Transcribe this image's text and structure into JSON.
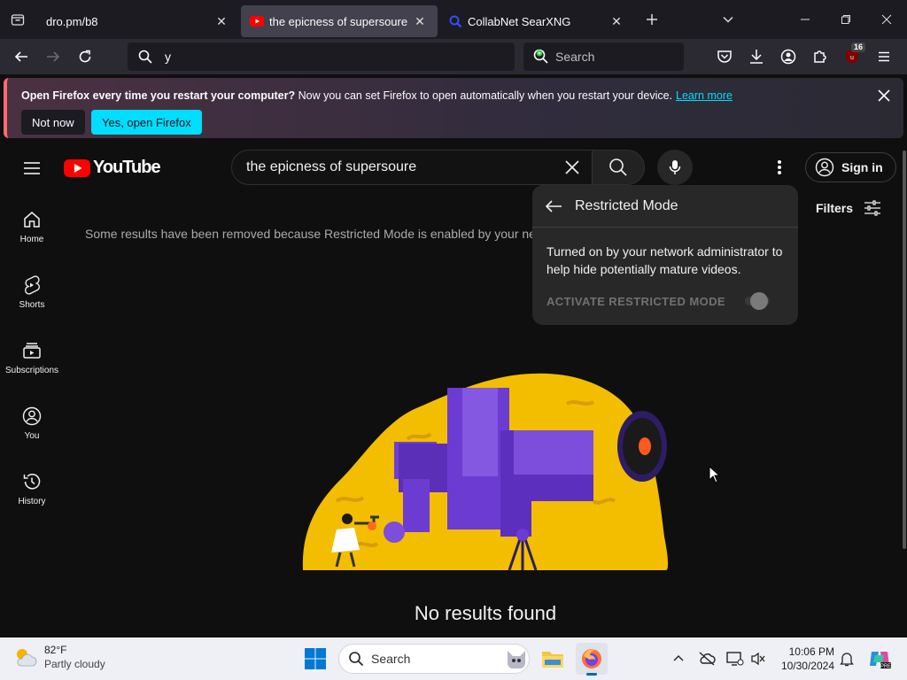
{
  "browser": {
    "tabs": [
      {
        "title": "dro.pm/b8",
        "active": false
      },
      {
        "title": "the epicness of supersoure - You",
        "active": true
      },
      {
        "title": "CollabNet SearXNG",
        "active": false
      }
    ],
    "url": "y",
    "search_placeholder": "Search",
    "extension_badge": "16"
  },
  "notification": {
    "bold": "Open Firefox every time you restart your computer?",
    "text": " Now you can set Firefox to open automatically when you restart your device.",
    "link": "Learn more",
    "btn_secondary": "Not now",
    "btn_primary": "Yes, open Firefox"
  },
  "youtube": {
    "logo_text": "YouTube",
    "query": "the epicness of supersoure",
    "sign_in": "Sign in",
    "sidebar": [
      {
        "label": "Home",
        "icon": "home-icon"
      },
      {
        "label": "Shorts",
        "icon": "shorts-icon"
      },
      {
        "label": "Subscriptions",
        "icon": "subscriptions-icon"
      },
      {
        "label": "You",
        "icon": "you-icon"
      },
      {
        "label": "History",
        "icon": "history-icon"
      }
    ],
    "notice": "Some results have been removed because Restricted Mode is enabled by your network administrator.",
    "filters": "Filters",
    "no_results": "No results found",
    "restricted": {
      "title": "Restricted Mode",
      "desc": "Turned on by your network administrator to help hide potentially mature videos.",
      "activate": "ACTIVATE RESTRICTED MODE",
      "enabled": false
    }
  },
  "taskbar": {
    "temp": "82°F",
    "condition": "Partly cloudy",
    "search": "Search",
    "time": "10:06 PM",
    "date": "10/30/2024"
  }
}
